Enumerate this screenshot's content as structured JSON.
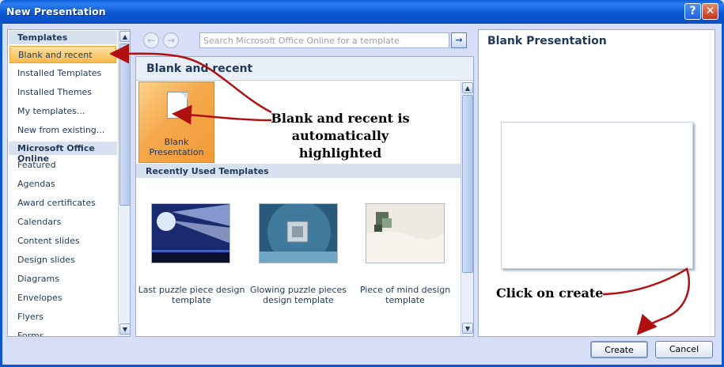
{
  "window": {
    "title": "New Presentation",
    "help_button": "?",
    "close_button": "✕"
  },
  "sidebar": {
    "section_templates": "Templates",
    "items_top": [
      {
        "label": "Blank and recent",
        "selected": true
      },
      {
        "label": "Installed Templates"
      },
      {
        "label": "Installed Themes"
      },
      {
        "label": "My templates..."
      },
      {
        "label": "New from existing..."
      }
    ],
    "section_online": "Microsoft Office Online",
    "items_online": [
      {
        "label": "Featured"
      },
      {
        "label": "Agendas"
      },
      {
        "label": "Award certificates"
      },
      {
        "label": "Calendars"
      },
      {
        "label": "Content slides"
      },
      {
        "label": "Design slides"
      },
      {
        "label": "Diagrams"
      },
      {
        "label": "Envelopes"
      },
      {
        "label": "Flyers"
      },
      {
        "label": "Forms"
      }
    ]
  },
  "search": {
    "placeholder": "Search Microsoft Office Online for a template"
  },
  "main": {
    "heading": "Blank and recent",
    "blank_tile_line1": "Blank",
    "blank_tile_line2": "Presentation",
    "recent_heading": "Recently Used Templates",
    "recent_templates": [
      {
        "line1": "Last puzzle piece design",
        "line2": "template"
      },
      {
        "line1": "Glowing puzzle pieces",
        "line2": "design template"
      },
      {
        "line1": "Piece of mind design",
        "line2": "template"
      }
    ]
  },
  "preview": {
    "title": "Blank Presentation"
  },
  "buttons": {
    "create": "Create",
    "cancel": "Cancel"
  },
  "annotations": {
    "highlight_line1": "Blank and recent is",
    "highlight_line2": "automatically",
    "highlight_line3": "highlighted",
    "create_note": "Click on create"
  },
  "colors": {
    "titlebar": "#0a5fd8",
    "selection": "#f9b94c",
    "annotation_arrow": "#b01010"
  }
}
